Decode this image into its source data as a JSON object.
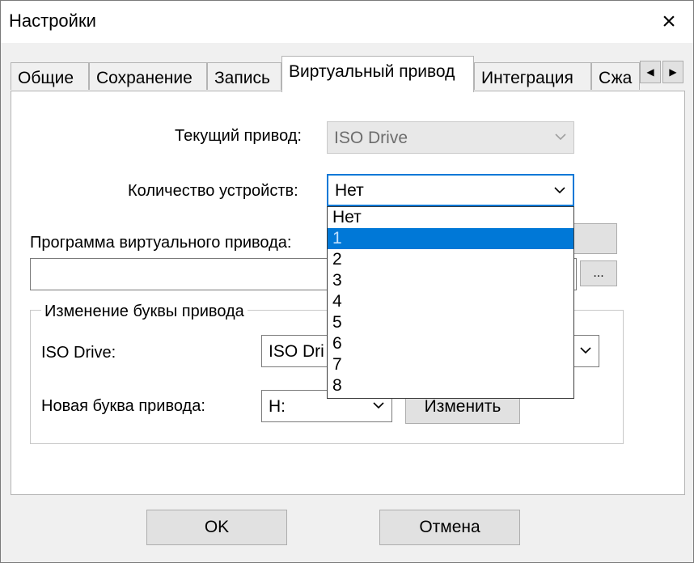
{
  "window": {
    "title": "Настройки",
    "close_icon": "×"
  },
  "tabs": [
    {
      "label": "Общие"
    },
    {
      "label": "Сохранение"
    },
    {
      "label": "Запись"
    },
    {
      "label": "Виртуальный привод",
      "active": true
    },
    {
      "label": "Интеграция"
    },
    {
      "label": "Сжа"
    }
  ],
  "tab_scroll": {
    "left": "◀",
    "right": "▶"
  },
  "current_drive": {
    "label": "Текущий привод:",
    "value": "ISO Drive"
  },
  "device_count": {
    "label": "Количество устройств:",
    "value": "Нет",
    "options": [
      "Нет",
      "1",
      "2",
      "3",
      "4",
      "5",
      "6",
      "7",
      "8"
    ],
    "highlighted": "1"
  },
  "virtual_drive_program": {
    "label": "Программа виртуального привода:",
    "value": "",
    "browse_label": "..."
  },
  "drive_letter_group": {
    "legend": "Изменение буквы привода",
    "drive_label": "ISO Drive:",
    "drive_value": "ISO Dri",
    "new_letter_label": "Новая буква привода:",
    "new_letter_value": "H:",
    "change_button": "Изменить"
  },
  "footer": {
    "ok_label": "OK",
    "cancel_label": "Отмена"
  },
  "colors": {
    "accent": "#0078d7",
    "window_bg": "#f0f0f0",
    "panel_bg": "#ffffff"
  }
}
